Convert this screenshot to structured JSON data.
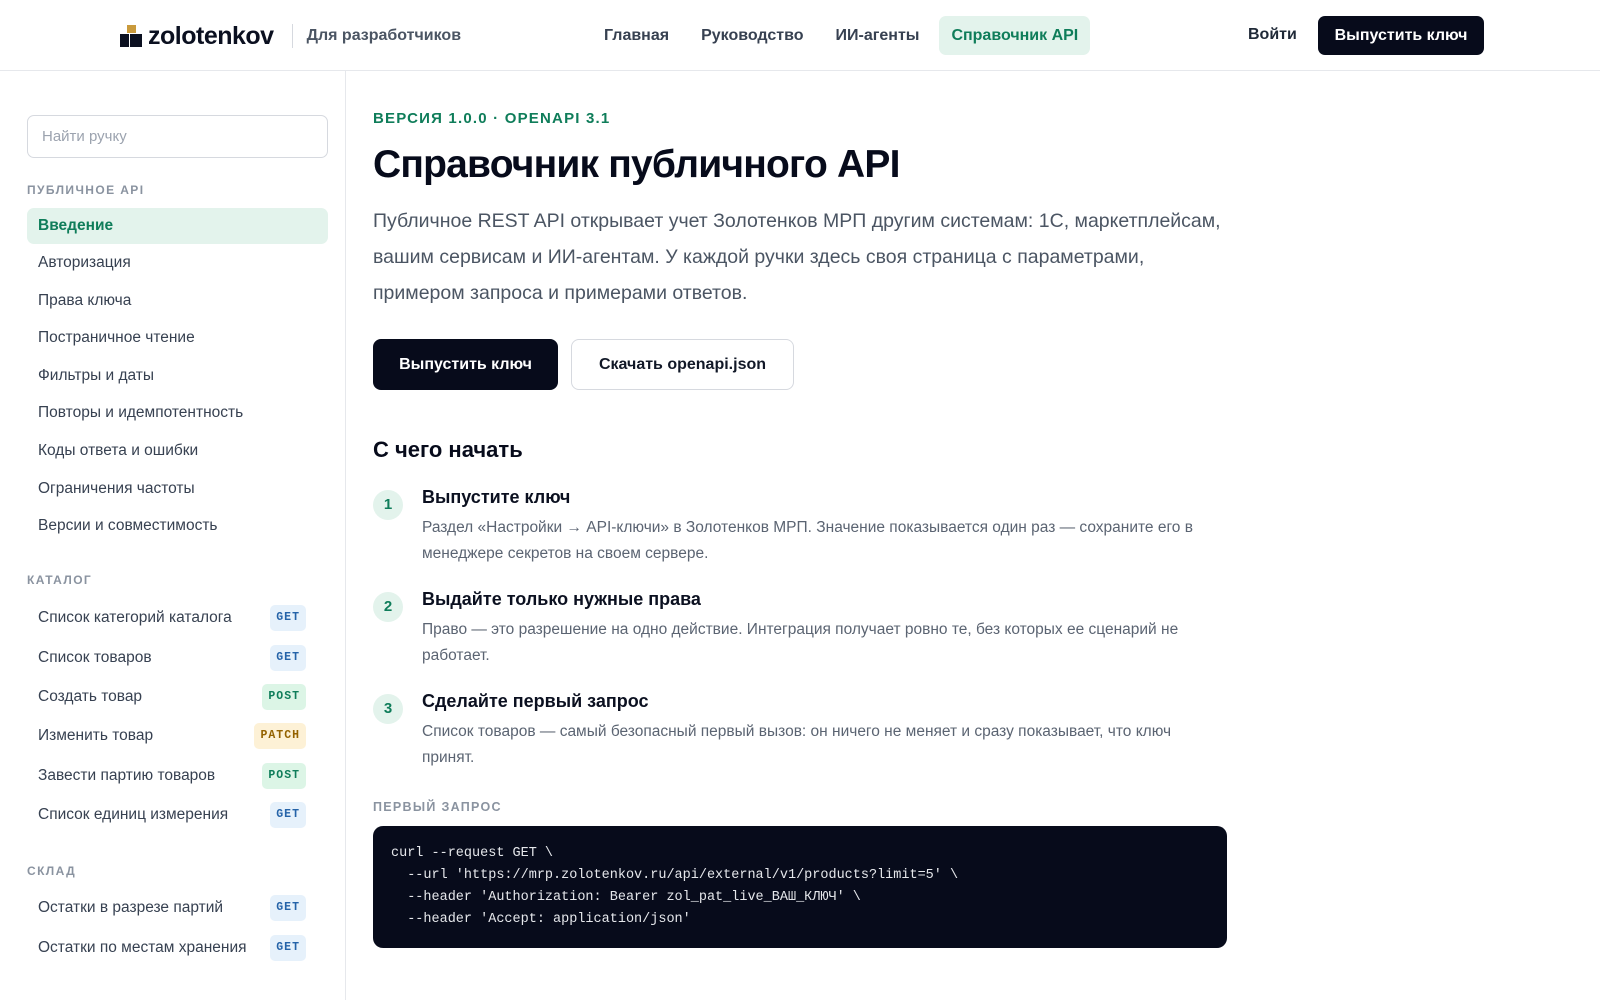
{
  "header": {
    "brand": "zolotenkov",
    "brand_sub": "Для разработчиков",
    "nav": [
      "Главная",
      "Руководство",
      "ИИ-агенты",
      "Справочник API"
    ],
    "login": "Войти",
    "cta": "Выпустить ключ"
  },
  "sidebar": {
    "search_placeholder": "Найти ручку",
    "sections": [
      {
        "title": "ПУБЛИЧНОЕ API",
        "items": [
          {
            "label": "Введение"
          },
          {
            "label": "Авторизация"
          },
          {
            "label": "Права ключа"
          },
          {
            "label": "Постраничное чтение"
          },
          {
            "label": "Фильтры и даты"
          },
          {
            "label": "Повторы и идемпотентность"
          },
          {
            "label": "Коды ответа и ошибки"
          },
          {
            "label": "Ограничения частоты"
          },
          {
            "label": "Версии и совместимость"
          }
        ]
      },
      {
        "title": "КАТАЛОГ",
        "items": [
          {
            "label": "Список категорий каталога",
            "method": "GET"
          },
          {
            "label": "Список товаров",
            "method": "GET"
          },
          {
            "label": "Создать товар",
            "method": "POST"
          },
          {
            "label": "Изменить товар",
            "method": "PATCH"
          },
          {
            "label": "Завести партию товаров",
            "method": "POST"
          },
          {
            "label": "Список единиц измерения",
            "method": "GET"
          }
        ]
      },
      {
        "title": "СКЛАД",
        "items": [
          {
            "label": "Остатки в разрезе партий",
            "method": "GET"
          },
          {
            "label": "Остатки по местам хранения",
            "method": "GET"
          }
        ]
      }
    ]
  },
  "main": {
    "eyebrow": "ВЕРСИЯ 1.0.0 · OPENAPI 3.1",
    "title": "Справочник публичного API",
    "lead": "Публичное REST API открывает учет Золотенков МРП другим системам: 1С, маркетплейсам, вашим сервисам и ИИ-агентам. У каждой ручки здесь своя страница с параметрами, примером запроса и примерами ответов.",
    "btn_primary": "Выпустить ключ",
    "btn_secondary": "Скачать openapi.json",
    "start_title": "С чего начать",
    "steps": [
      {
        "num": "1",
        "title": "Выпустите ключ",
        "text": "Раздел «Настройки → API-ключи» в Золотенков МРП. Значение показывается один раз — сохраните его в менеджере секретов на своем сервере."
      },
      {
        "num": "2",
        "title": "Выдайте только нужные права",
        "text": "Право — это разрешение на одно действие. Интеграция получает ровно те, без которых ее сценарий не работает."
      },
      {
        "num": "3",
        "title": "Сделайте первый запрос",
        "text": "Список товаров — самый безопасный первый вызов: он ничего не меняет и сразу показывает, что ключ принят."
      }
    ],
    "code_label": "ПЕРВЫЙ ЗАПРОС",
    "code_lines": [
      "curl --request GET \\",
      "  --url 'https://mrp.zolotenkov.ru/api/external/v1/products?limit=5' \\",
      "  --header 'Authorization: Bearer zol_pat_live_ВАШ_КЛЮЧ' \\",
      "  --header 'Accept: application/json'"
    ]
  }
}
